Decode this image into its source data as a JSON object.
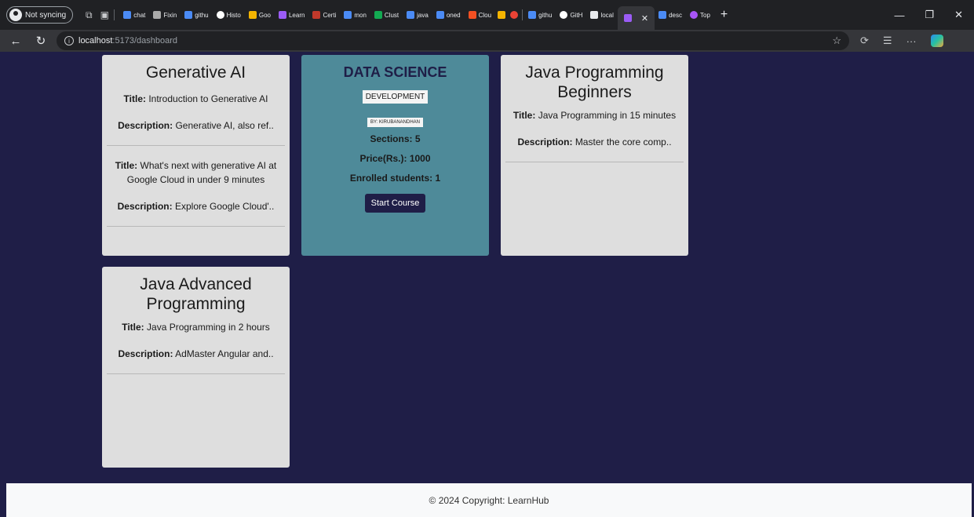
{
  "browser": {
    "sync_label": "Not syncing",
    "tabs": [
      {
        "label": "chat"
      },
      {
        "label": "Fixin"
      },
      {
        "label": "githu"
      },
      {
        "label": "Histo"
      },
      {
        "label": "Goo"
      },
      {
        "label": "Learn"
      },
      {
        "label": "Certi"
      },
      {
        "label": "mon"
      },
      {
        "label": "Clust"
      },
      {
        "label": "java"
      },
      {
        "label": "oned"
      },
      {
        "label": "Clou"
      },
      {
        "label": "githu"
      },
      {
        "label": "GitH"
      },
      {
        "label": "local"
      }
    ],
    "active_tab_label": "",
    "tabs_after": [
      {
        "label": "desc"
      },
      {
        "label": "Top"
      }
    ],
    "url_host": "localhost",
    "url_path": ":5173/dashboard",
    "colors": {
      "chrome_bg": "#202124",
      "address_bg": "#35363a"
    }
  },
  "page": {
    "background": "#1f1e47",
    "courses": [
      {
        "title": "Generative AI",
        "items": [
          {
            "title_label": "Title:",
            "title": "Introduction to Generative AI",
            "desc_label": "Description:",
            "desc": "Generative AI, also ref.."
          },
          {
            "title_label": "Title:",
            "title": "What's next with generative AI at Google Cloud in under 9 minutes",
            "desc_label": "Description:",
            "desc": "Explore Google Cloud'.."
          }
        ]
      },
      {
        "title": "Java Programming Beginners",
        "items": [
          {
            "title_label": "Title:",
            "title": "Java Programming in 15 minutes",
            "desc_label": "Description:",
            "desc": "Master the core comp.."
          }
        ]
      },
      {
        "title": "Java Advanced Programming",
        "items": [
          {
            "title_label": "Title:",
            "title": "Java Programming in 2 hours",
            "desc_label": "Description:",
            "desc": "AdMaster Angular and.."
          }
        ]
      }
    ],
    "featured": {
      "title": "DATA SCIENCE",
      "category": "DEVELOPMENT",
      "author": "BY: KIRUBANANDHAN",
      "sections": "Sections: 5",
      "price": "Price(Rs.): 1000",
      "enrolled": "Enrolled students: 1",
      "button": "Start Course",
      "color": "#4e8a99"
    }
  },
  "footer": {
    "text": "© 2024 Copyright: LearnHub"
  }
}
